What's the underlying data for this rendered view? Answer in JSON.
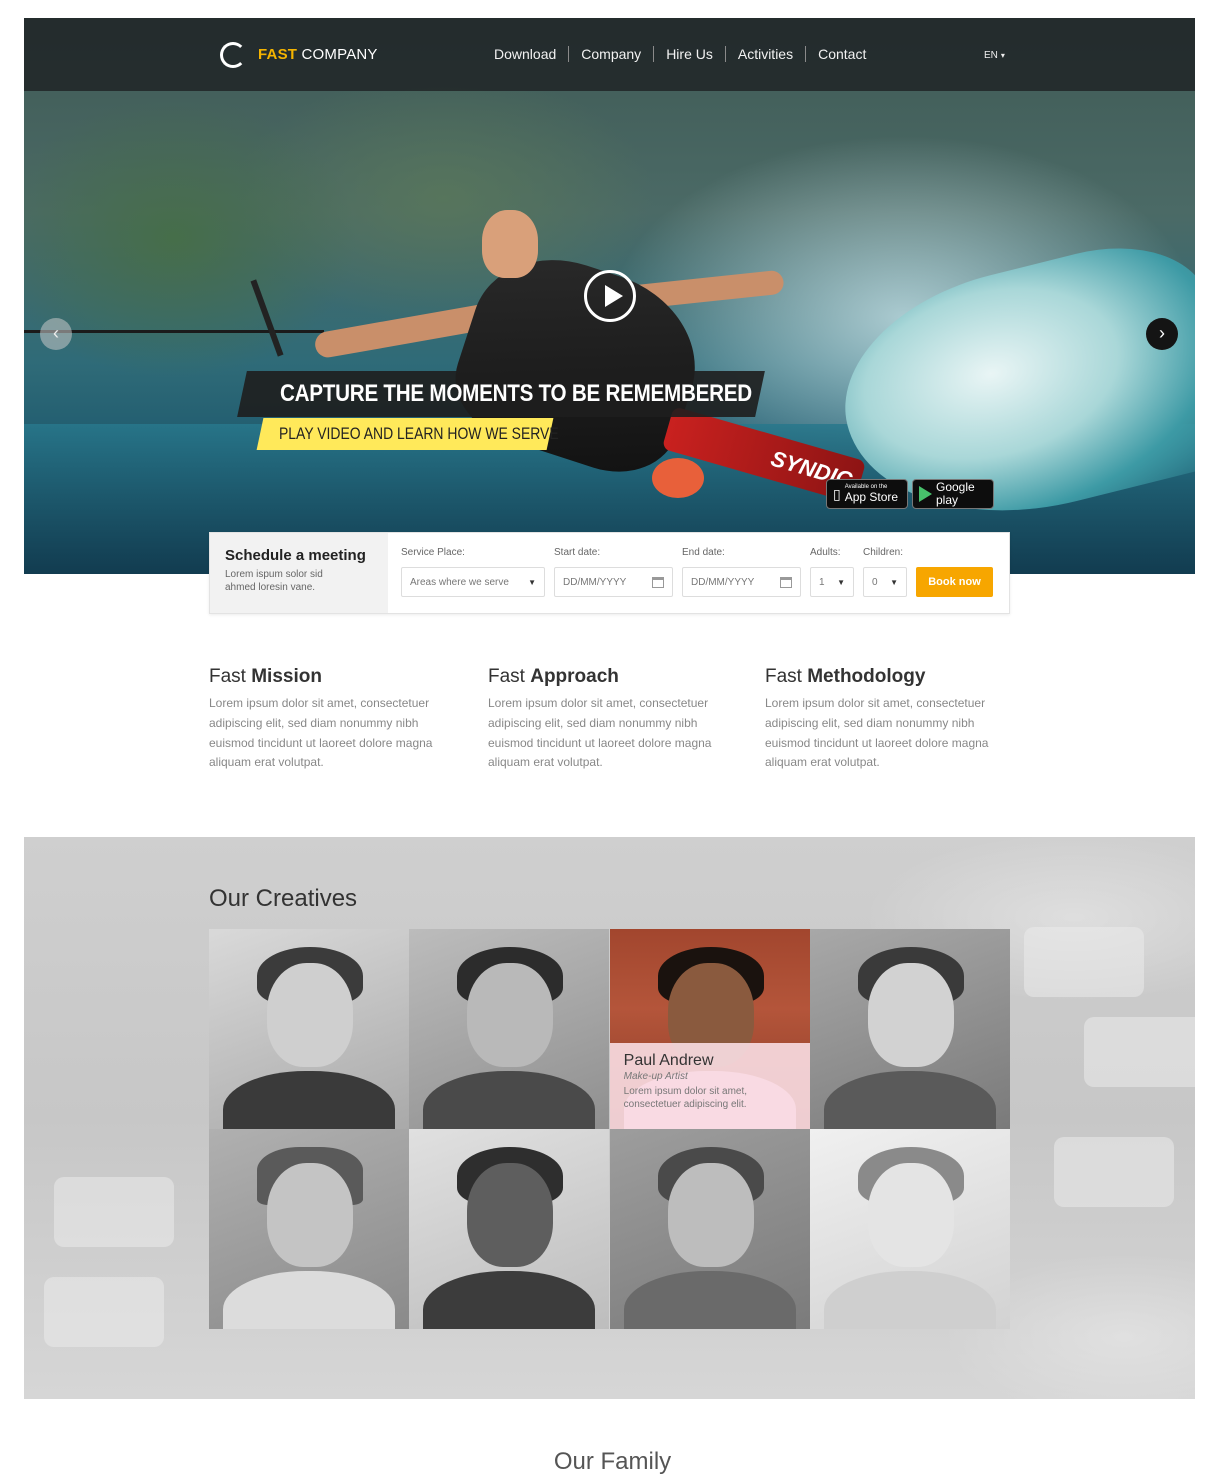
{
  "brand": {
    "strong": "FAST",
    "rest": " COMPANY",
    "accent_color": "#f5b400"
  },
  "nav": {
    "items": [
      "Download",
      "Company",
      "Hire Us",
      "Activities",
      "Contact"
    ],
    "language": "EN"
  },
  "hero": {
    "headline": "CAPTURE THE MOMENTS TO BE REMEMBERED",
    "subline": "PLAY VIDEO AND LEARN HOW WE SERVE",
    "ski_text": "SYNDIC",
    "app_store": {
      "small": "Available on the",
      "big": "App Store"
    },
    "google_play": {
      "big": "Google play"
    },
    "prev_icon": "chevron-left-icon",
    "next_icon": "chevron-right-icon",
    "play_icon": "play-icon"
  },
  "booking": {
    "title": "Schedule a meeting",
    "desc": "Lorem ispum solor sid ahmed loresin vane.",
    "service_label": "Service Place:",
    "service_value": "Areas where we serve",
    "start_label": "Start date:",
    "start_placeholder": "DD/MM/YYYY",
    "end_label": "End date:",
    "end_placeholder": "DD/MM/YYYY",
    "adults_label": "Adults:",
    "adults_value": "1",
    "children_label": "Children:",
    "children_value": "0",
    "button": "Book now",
    "button_color": "#f7a600"
  },
  "features": [
    {
      "prefix": "Fast ",
      "bold": "Mission",
      "text": "Lorem ipsum dolor sit amet, consectetuer adipiscing elit, sed diam nonummy nibh euismod tincidunt ut laoreet dolore magna aliquam erat volutpat."
    },
    {
      "prefix": "Fast ",
      "bold": "Approach",
      "text": "Lorem ipsum dolor sit amet, consectetuer adipiscing elit, sed diam nonummy nibh euismod tincidunt ut laoreet dolore magna aliquam erat volutpat."
    },
    {
      "prefix": "Fast ",
      "bold": "Methodology",
      "text": "Lorem ipsum dolor sit amet, consectetuer adipiscing elit, sed diam nonummy nibh euismod tincidunt ut laoreet dolore magna aliquam erat volutpat."
    }
  ],
  "creatives": {
    "title": "Our Creatives",
    "active_member": {
      "name": "Paul Andrew",
      "role": "Make-up Artist",
      "desc": "Lorem ipsum dolor sit amet, consectetuer adipiscing elit."
    }
  },
  "family": {
    "title": "Our Family"
  }
}
